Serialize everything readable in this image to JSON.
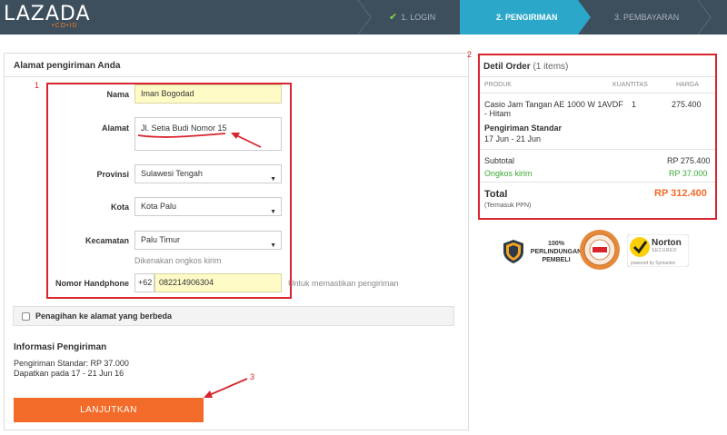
{
  "header": {
    "logo": "LAZADA",
    "logo_sub": "•CO•ID",
    "steps": [
      {
        "label": "1. LOGIN",
        "done": true
      },
      {
        "label": "2. PENGIRIMAN",
        "active": true
      },
      {
        "label": "3. PEMBAYARAN"
      }
    ],
    "check_icon": "✔"
  },
  "colors": {
    "accent": "#f26b28",
    "nav_bg": "#3d4e5c",
    "active_step": "#2aa7c9",
    "annotation": "#d9232d",
    "green": "#3aa935"
  },
  "shipping_form": {
    "title": "Alamat pengiriman Anda",
    "nama_label": "Nama",
    "nama_value": "Iman Bogodad",
    "alamat_label": "Alamat",
    "alamat_value": "Jl. Setia Budi Nomor 15",
    "provinsi_label": "Provinsi",
    "provinsi_value": "Sulawesi Tengah",
    "kota_label": "Kota",
    "kota_value": "Kota Palu",
    "kecamatan_label": "Kecamatan",
    "kecamatan_value": "Palu Timur",
    "kecamatan_hint": "Dikenakan ongkos kirim",
    "phone_label": "Nomor Handphone",
    "phone_prefix": "+62",
    "phone_value": "082214906304",
    "phone_hint": "Untuk memastikan pengiriman",
    "different_billing": "Penagihan ke alamat yang berbeda"
  },
  "shipping_info": {
    "title": "Informasi Pengiriman",
    "line1": "Pengiriman Standar: RP 37.000",
    "line2": "Dapatkan pada 17 - 21 Jun 16"
  },
  "continue_button": "LANJUTKAN",
  "order": {
    "title": "Detil Order",
    "count": "(1 items)",
    "col_product": "PRODUK",
    "col_qty": "KUANTITAS",
    "col_price": "HARGA",
    "product_line1": "Casio Jam Tangan AE 1000 W 1AVDF",
    "product_line2": "- Hitam",
    "qty": "1",
    "price": "275.400",
    "shipping_type": "Pengiriman Standar",
    "shipping_date": "17 Jun - 21 Jun",
    "subtotal_label": "Subtotal",
    "subtotal_value": "RP 275.400",
    "shipping_label": "Ongkos kirim",
    "shipping_value": "RP 37.000",
    "total_label": "Total",
    "total_value": "RP 312.400",
    "tax_note": "(Termasuk PPN)"
  },
  "badges": {
    "protection_line1": "100%",
    "protection_line2": "PERLINDUNGAN",
    "protection_line3": "PEMBELI",
    "norton": "Norton",
    "norton_sub": "SECURED",
    "norton_by": "powered by Symantec"
  },
  "annotations": [
    "1",
    "2",
    "3"
  ]
}
